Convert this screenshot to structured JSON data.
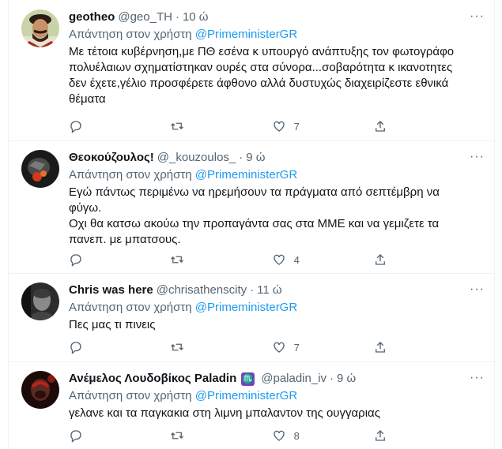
{
  "reply_prefix": "Απάντηση στον χρήστη",
  "tweets": [
    {
      "name": "geotheo",
      "handle": "@geo_TH",
      "time": "10 ώ",
      "mention": "@PrimeministerGR",
      "lines": [
        "Με τέτοια κυβέρνηση,με ΠΘ εσένα κ υπουργό ανάπτυξης τον φωτογράφο",
        "πολυέλαιων σχηματίστηκαν ουρές στα σύνορα...σοβαρότητα κ ικανοτητες",
        "δεν έχετε,γέλιο προσφέρετε άφθονο αλλά δυστυχώς διαχειρίζεστε εθνικά",
        "θέματα"
      ],
      "likes": "7"
    },
    {
      "name": "Θεοκούζουλος!",
      "handle": "@_kouzoulos_",
      "time": "9 ώ",
      "mention": "@PrimeministerGR",
      "lines": [
        "Εγώ πάντως περιμένω να ηρεμήσουν τα πράγματα από σεπτέμβρη να",
        "φύγω.",
        "Οχι θα κατσω ακούω την προπαγάντα σας στα ΜΜΕ και να γεμιζετε τα",
        "πανεπ. με μπατσους."
      ],
      "likes": "4"
    },
    {
      "name": "Chris was here",
      "handle": "@chrisathenscity",
      "time": "11 ώ",
      "mention": "@PrimeministerGR",
      "lines": [
        "Πες μας τι πινεις"
      ],
      "likes": "7"
    },
    {
      "name": "Ανέμελος Λουδοβίκος Paladin",
      "badge": "♏",
      "handle": "@paladin_iv",
      "time": "9 ώ",
      "mention": "@PrimeministerGR",
      "lines": [
        "γελανε και τα παγκακια στη λιμνη μπαλαντον της ουγγαριας"
      ],
      "likes": "8"
    }
  ]
}
